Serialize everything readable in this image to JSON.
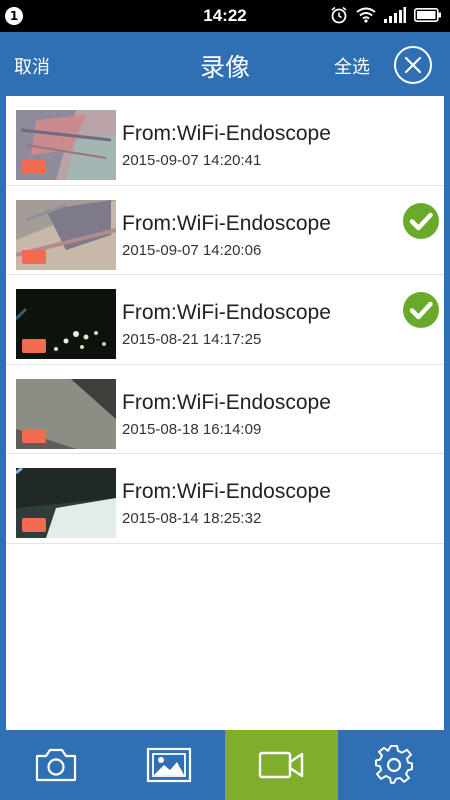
{
  "status_bar": {
    "notification_count": "1",
    "time": "14:22",
    "icons": [
      "alarm-icon",
      "wifi-icon",
      "signal-icon",
      "battery-icon"
    ]
  },
  "header": {
    "cancel_label": "取消",
    "title": "录像",
    "select_all_label": "全选",
    "close_icon": "close-icon"
  },
  "videos": [
    {
      "source": "From:WiFi-Endoscope",
      "date": "2015-09-07 14:20:41",
      "selected": false
    },
    {
      "source": "From:WiFi-Endoscope",
      "date": "2015-09-07 14:20:06",
      "selected": true
    },
    {
      "source": "From:WiFi-Endoscope",
      "date": "2015-08-21 14:17:25",
      "selected": true
    },
    {
      "source": "From:WiFi-Endoscope",
      "date": "2015-08-18 16:14:09",
      "selected": false
    },
    {
      "source": "From:WiFi-Endoscope",
      "date": "2015-08-14 18:25:32",
      "selected": false
    }
  ],
  "bottom_nav": {
    "tabs": [
      {
        "icon": "camera-icon",
        "active": false
      },
      {
        "icon": "gallery-icon",
        "active": false
      },
      {
        "icon": "video-icon",
        "active": true
      },
      {
        "icon": "settings-icon",
        "active": false
      }
    ]
  },
  "colors": {
    "primary": "#2f6fb3",
    "active_tab": "#7fad2c",
    "check_green": "#6aaa2a",
    "record_mark": "#f26b50"
  }
}
